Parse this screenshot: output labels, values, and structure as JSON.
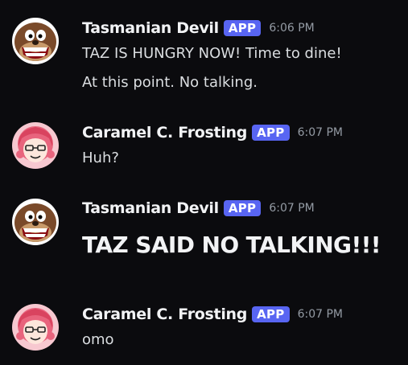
{
  "messages": [
    {
      "author": "Tasmanian Devil",
      "badge": "APP",
      "time": "6:06 PM",
      "lines": [
        "TAZ IS HUNGRY NOW! Time to dine!",
        "At this point. No talking."
      ]
    },
    {
      "author": "Caramel C. Frosting",
      "badge": "APP",
      "time": "6:07 PM",
      "lines": [
        "Huh?"
      ]
    },
    {
      "author": "Tasmanian Devil",
      "badge": "APP",
      "time": "6:07 PM",
      "lines": [
        "TAZ SAID NO TALKING!!!"
      ]
    },
    {
      "author": "Caramel C. Frosting",
      "badge": "APP",
      "time": "6:07 PM",
      "lines": [
        "omo"
      ]
    }
  ],
  "colors": {
    "background": "#0b0b0e",
    "badge": "#5865f2",
    "author": "#f2f3f5",
    "timestamp": "#949ba4",
    "message_text": "#dbdee1"
  },
  "icons": [
    "tasmanian-devil-avatar-icon",
    "caramel-frosting-avatar-icon"
  ]
}
